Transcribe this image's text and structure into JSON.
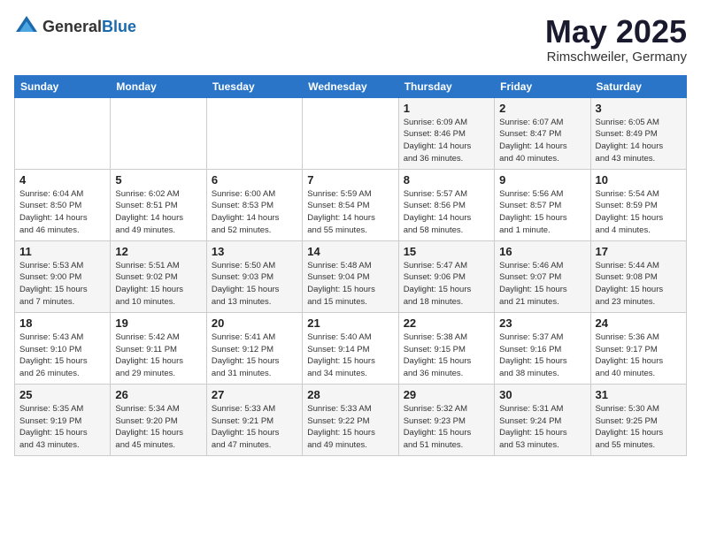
{
  "header": {
    "logo_general": "General",
    "logo_blue": "Blue",
    "title": "May 2025",
    "location": "Rimschweiler, Germany"
  },
  "days_of_week": [
    "Sunday",
    "Monday",
    "Tuesday",
    "Wednesday",
    "Thursday",
    "Friday",
    "Saturday"
  ],
  "weeks": [
    {
      "days": [
        {
          "num": "",
          "info": ""
        },
        {
          "num": "",
          "info": ""
        },
        {
          "num": "",
          "info": ""
        },
        {
          "num": "",
          "info": ""
        },
        {
          "num": "1",
          "info": "Sunrise: 6:09 AM\nSunset: 8:46 PM\nDaylight: 14 hours\nand 36 minutes."
        },
        {
          "num": "2",
          "info": "Sunrise: 6:07 AM\nSunset: 8:47 PM\nDaylight: 14 hours\nand 40 minutes."
        },
        {
          "num": "3",
          "info": "Sunrise: 6:05 AM\nSunset: 8:49 PM\nDaylight: 14 hours\nand 43 minutes."
        }
      ]
    },
    {
      "days": [
        {
          "num": "4",
          "info": "Sunrise: 6:04 AM\nSunset: 8:50 PM\nDaylight: 14 hours\nand 46 minutes."
        },
        {
          "num": "5",
          "info": "Sunrise: 6:02 AM\nSunset: 8:51 PM\nDaylight: 14 hours\nand 49 minutes."
        },
        {
          "num": "6",
          "info": "Sunrise: 6:00 AM\nSunset: 8:53 PM\nDaylight: 14 hours\nand 52 minutes."
        },
        {
          "num": "7",
          "info": "Sunrise: 5:59 AM\nSunset: 8:54 PM\nDaylight: 14 hours\nand 55 minutes."
        },
        {
          "num": "8",
          "info": "Sunrise: 5:57 AM\nSunset: 8:56 PM\nDaylight: 14 hours\nand 58 minutes."
        },
        {
          "num": "9",
          "info": "Sunrise: 5:56 AM\nSunset: 8:57 PM\nDaylight: 15 hours\nand 1 minute."
        },
        {
          "num": "10",
          "info": "Sunrise: 5:54 AM\nSunset: 8:59 PM\nDaylight: 15 hours\nand 4 minutes."
        }
      ]
    },
    {
      "days": [
        {
          "num": "11",
          "info": "Sunrise: 5:53 AM\nSunset: 9:00 PM\nDaylight: 15 hours\nand 7 minutes."
        },
        {
          "num": "12",
          "info": "Sunrise: 5:51 AM\nSunset: 9:02 PM\nDaylight: 15 hours\nand 10 minutes."
        },
        {
          "num": "13",
          "info": "Sunrise: 5:50 AM\nSunset: 9:03 PM\nDaylight: 15 hours\nand 13 minutes."
        },
        {
          "num": "14",
          "info": "Sunrise: 5:48 AM\nSunset: 9:04 PM\nDaylight: 15 hours\nand 15 minutes."
        },
        {
          "num": "15",
          "info": "Sunrise: 5:47 AM\nSunset: 9:06 PM\nDaylight: 15 hours\nand 18 minutes."
        },
        {
          "num": "16",
          "info": "Sunrise: 5:46 AM\nSunset: 9:07 PM\nDaylight: 15 hours\nand 21 minutes."
        },
        {
          "num": "17",
          "info": "Sunrise: 5:44 AM\nSunset: 9:08 PM\nDaylight: 15 hours\nand 23 minutes."
        }
      ]
    },
    {
      "days": [
        {
          "num": "18",
          "info": "Sunrise: 5:43 AM\nSunset: 9:10 PM\nDaylight: 15 hours\nand 26 minutes."
        },
        {
          "num": "19",
          "info": "Sunrise: 5:42 AM\nSunset: 9:11 PM\nDaylight: 15 hours\nand 29 minutes."
        },
        {
          "num": "20",
          "info": "Sunrise: 5:41 AM\nSunset: 9:12 PM\nDaylight: 15 hours\nand 31 minutes."
        },
        {
          "num": "21",
          "info": "Sunrise: 5:40 AM\nSunset: 9:14 PM\nDaylight: 15 hours\nand 34 minutes."
        },
        {
          "num": "22",
          "info": "Sunrise: 5:38 AM\nSunset: 9:15 PM\nDaylight: 15 hours\nand 36 minutes."
        },
        {
          "num": "23",
          "info": "Sunrise: 5:37 AM\nSunset: 9:16 PM\nDaylight: 15 hours\nand 38 minutes."
        },
        {
          "num": "24",
          "info": "Sunrise: 5:36 AM\nSunset: 9:17 PM\nDaylight: 15 hours\nand 40 minutes."
        }
      ]
    },
    {
      "days": [
        {
          "num": "25",
          "info": "Sunrise: 5:35 AM\nSunset: 9:19 PM\nDaylight: 15 hours\nand 43 minutes."
        },
        {
          "num": "26",
          "info": "Sunrise: 5:34 AM\nSunset: 9:20 PM\nDaylight: 15 hours\nand 45 minutes."
        },
        {
          "num": "27",
          "info": "Sunrise: 5:33 AM\nSunset: 9:21 PM\nDaylight: 15 hours\nand 47 minutes."
        },
        {
          "num": "28",
          "info": "Sunrise: 5:33 AM\nSunset: 9:22 PM\nDaylight: 15 hours\nand 49 minutes."
        },
        {
          "num": "29",
          "info": "Sunrise: 5:32 AM\nSunset: 9:23 PM\nDaylight: 15 hours\nand 51 minutes."
        },
        {
          "num": "30",
          "info": "Sunrise: 5:31 AM\nSunset: 9:24 PM\nDaylight: 15 hours\nand 53 minutes."
        },
        {
          "num": "31",
          "info": "Sunrise: 5:30 AM\nSunset: 9:25 PM\nDaylight: 15 hours\nand 55 minutes."
        }
      ]
    }
  ]
}
